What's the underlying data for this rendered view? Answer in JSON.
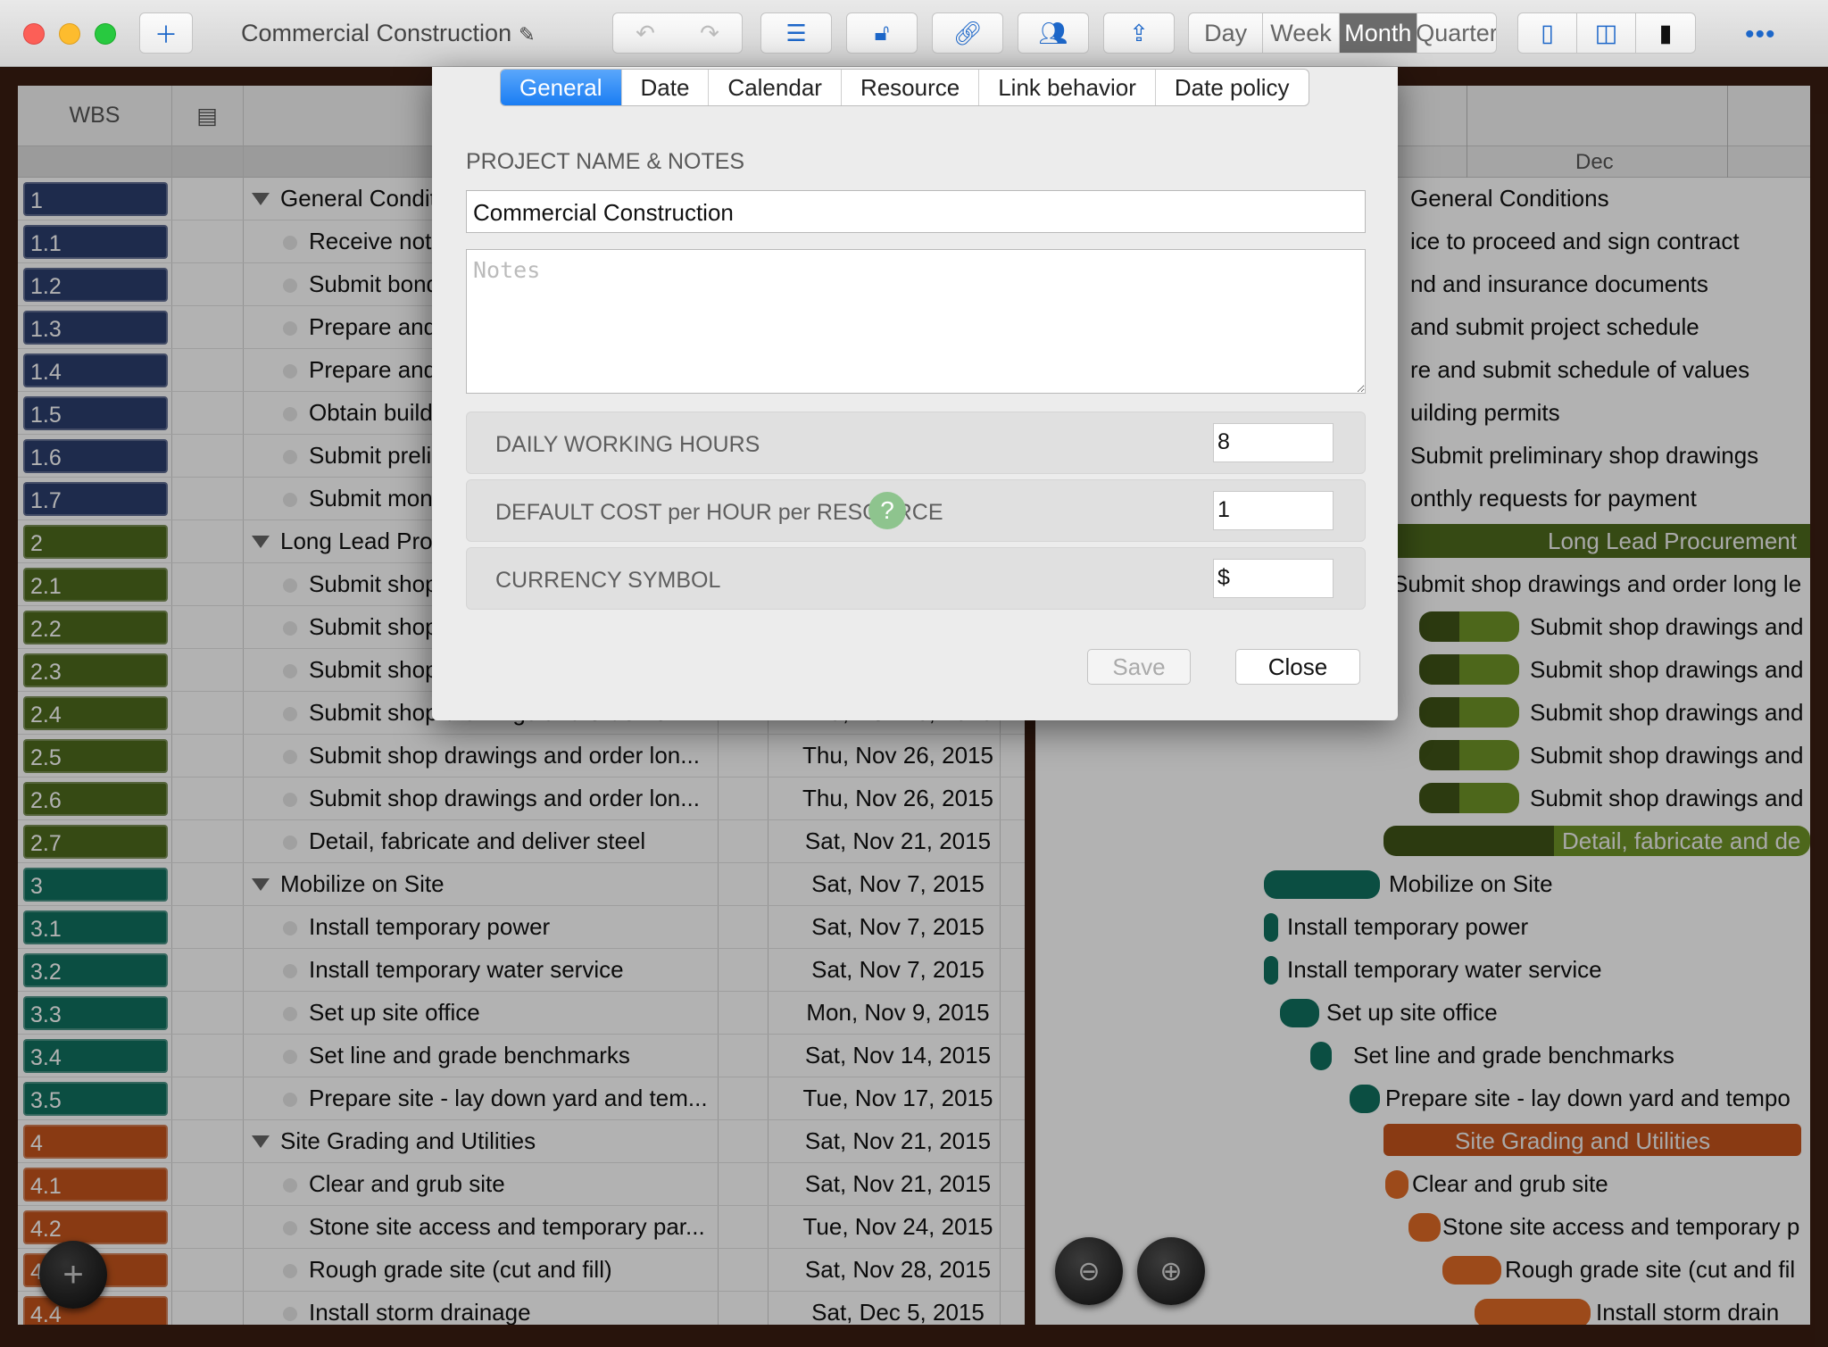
{
  "toolbar": {
    "document_title": "Commercial Construction",
    "view_day": "Day",
    "view_week": "Week",
    "view_month": "Month",
    "view_quarter": "Quarter"
  },
  "table": {
    "wbs_header": "WBS",
    "rows": [
      {
        "wbs": "1",
        "name": "General Conditions",
        "date": "",
        "color": "#2c3e6e",
        "summary": true
      },
      {
        "wbs": "1.1",
        "name": "Receive notice to proceed and sign contract",
        "date": "",
        "color": "#2c3e6e"
      },
      {
        "wbs": "1.2",
        "name": "Submit bond and insurance documents",
        "date": "",
        "color": "#2c3e6e"
      },
      {
        "wbs": "1.3",
        "name": "Prepare and submit project schedule",
        "date": "",
        "color": "#2c3e6e"
      },
      {
        "wbs": "1.4",
        "name": "Prepare and submit schedule of values",
        "date": "",
        "color": "#2c3e6e"
      },
      {
        "wbs": "1.5",
        "name": "Obtain building permits",
        "date": "",
        "color": "#2c3e6e"
      },
      {
        "wbs": "1.6",
        "name": "Submit preliminary shop drawings",
        "date": "",
        "color": "#2c3e6e"
      },
      {
        "wbs": "1.7",
        "name": "Submit monthly requests for payment",
        "date": "",
        "color": "#2c3e6e"
      },
      {
        "wbs": "2",
        "name": "Long Lead Procurement",
        "date": "",
        "color": "#4e6b1e",
        "summary": true
      },
      {
        "wbs": "2.1",
        "name": "Submit shop drawings and order long lead items",
        "date": "",
        "color": "#4e6b1e"
      },
      {
        "wbs": "2.2",
        "name": "Submit shop drawings and order long lead items",
        "date": "",
        "color": "#4e6b1e"
      },
      {
        "wbs": "2.3",
        "name": "Submit shop drawings and order long lead items",
        "date": "",
        "color": "#4e6b1e"
      },
      {
        "wbs": "2.4",
        "name": "Submit shop drawings and order lon...",
        "date": "Thu, Nov 26, 2015",
        "color": "#4e6b1e"
      },
      {
        "wbs": "2.5",
        "name": "Submit shop drawings and order lon...",
        "date": "Thu, Nov 26, 2015",
        "color": "#4e6b1e"
      },
      {
        "wbs": "2.6",
        "name": "Submit shop drawings and order lon...",
        "date": "Thu, Nov 26, 2015",
        "color": "#4e6b1e"
      },
      {
        "wbs": "2.7",
        "name": "Detail, fabricate and deliver steel",
        "date": "Sat, Nov 21, 2015",
        "color": "#4e6b1e"
      },
      {
        "wbs": "3",
        "name": "Mobilize on Site",
        "date": "Sat, Nov 7, 2015",
        "color": "#11705f",
        "summary": true
      },
      {
        "wbs": "3.1",
        "name": "Install temporary power",
        "date": "Sat, Nov 7, 2015",
        "color": "#11705f"
      },
      {
        "wbs": "3.2",
        "name": "Install temporary water service",
        "date": "Sat, Nov 7, 2015",
        "color": "#11705f"
      },
      {
        "wbs": "3.3",
        "name": "Set up site office",
        "date": "Mon, Nov 9, 2015",
        "color": "#11705f"
      },
      {
        "wbs": "3.4",
        "name": "Set line and grade benchmarks",
        "date": "Sat, Nov 14, 2015",
        "color": "#11705f"
      },
      {
        "wbs": "3.5",
        "name": "Prepare site - lay down yard and tem...",
        "date": "Tue, Nov 17, 2015",
        "color": "#11705f"
      },
      {
        "wbs": "4",
        "name": "Site Grading and Utilities",
        "date": "Sat, Nov 21, 2015",
        "color": "#c4541c",
        "summary": true
      },
      {
        "wbs": "4.1",
        "name": "Clear and grub site",
        "date": "Sat, Nov 21, 2015",
        "color": "#c4541c"
      },
      {
        "wbs": "4.2",
        "name": "Stone site access and temporary par...",
        "date": "Tue, Nov 24, 2015",
        "color": "#c4541c"
      },
      {
        "wbs": "4.3",
        "name": "Rough grade site (cut and fill)",
        "date": "Sat, Nov 28, 2015",
        "color": "#c4541c"
      },
      {
        "wbs": "4.4",
        "name": "Install storm drainage",
        "date": "Sat, Dec 5, 2015",
        "color": "#c4541c"
      }
    ]
  },
  "gantt": {
    "month_label": "Dec",
    "labels": [
      "General Conditions",
      "ice to proceed and sign contract",
      "nd and insurance documents",
      "and submit project schedule",
      "re and submit schedule of values",
      "uilding permits",
      "Submit preliminary shop drawings",
      "onthly requests for payment",
      "Long Lead Procurement",
      "Submit shop drawings and order long le",
      "Submit shop drawings and",
      "Submit shop drawings and",
      "Submit shop drawings and",
      "Submit shop drawings and",
      "Submit shop drawings and",
      "Detail, fabricate and de",
      "Mobilize on Site",
      "Install temporary power",
      "Install temporary water service",
      "Set up site office",
      "Set line and grade benchmarks",
      "Prepare site - lay down yard and tempo",
      "Site Grading and Utilities",
      "Clear and grub site",
      "Stone site access and temporary p",
      "Rough grade site (cut and fil",
      "Install storm drain"
    ]
  },
  "dialog": {
    "tabs": [
      "General",
      "Date",
      "Calendar",
      "Resource",
      "Link behavior",
      "Date policy"
    ],
    "section_title": "PROJECT NAME & NOTES",
    "project_name": "Commercial Construction",
    "notes_placeholder": "Notes",
    "daily_hours_label": "DAILY WORKING HOURS",
    "daily_hours_value": "8",
    "cost_label": "DEFAULT COST per HOUR per RESOURCE",
    "cost_value": "1",
    "currency_label": "CURRENCY SYMBOL",
    "currency_value": "$",
    "help_glyph": "?",
    "save_label": "Save",
    "close_label": "Close"
  }
}
